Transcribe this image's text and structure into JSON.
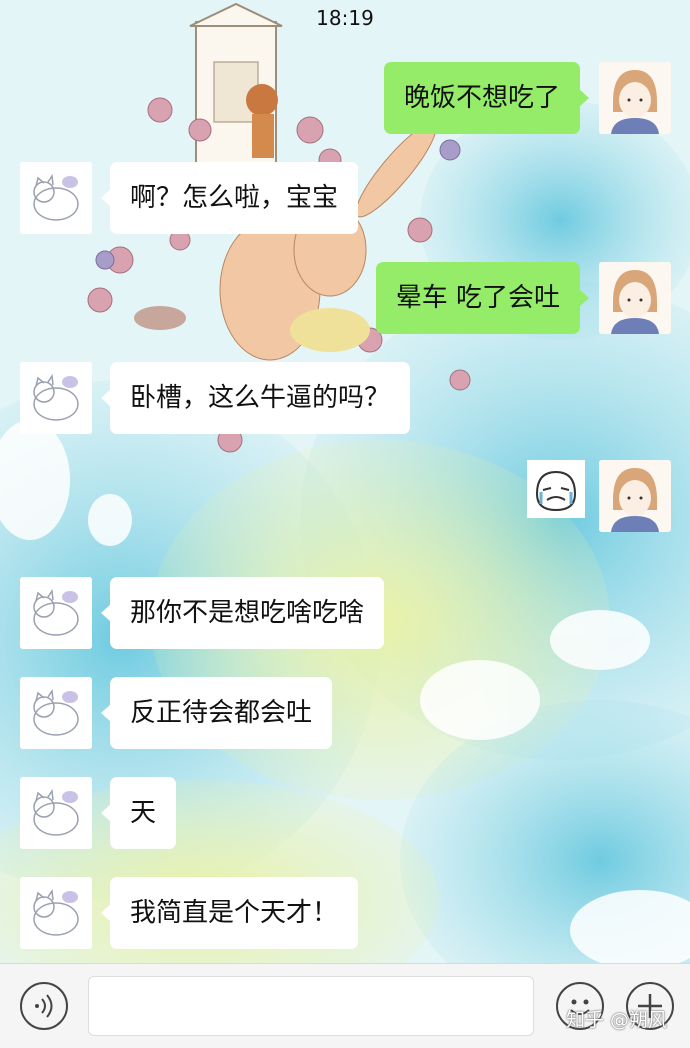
{
  "status_bar": {
    "time": "18:19"
  },
  "messages": [
    {
      "side": "right",
      "text": "晚饭不想吃了"
    },
    {
      "side": "left",
      "text": "啊？怎么啦，宝宝"
    },
    {
      "side": "right",
      "text": "晕车 吃了会吐"
    },
    {
      "side": "left",
      "text": "卧槽，这么牛逼的吗？"
    },
    {
      "side": "right",
      "sticker": "crying-face-sticker"
    },
    {
      "side": "left",
      "text": "那你不是想吃啥吃啥"
    },
    {
      "side": "left",
      "text": "反正待会都会吐"
    },
    {
      "side": "left",
      "text": "天"
    },
    {
      "side": "left",
      "text": "我简直是个天才！"
    }
  ],
  "input_bar": {
    "voice_icon": "voice-icon",
    "emoji_icon": "emoji-icon",
    "plus_icon": "plus-icon",
    "value": ""
  },
  "watermark": "知乎 @朔风",
  "colors": {
    "sent_bubble": "#95ec69",
    "received_bubble": "#ffffff"
  }
}
